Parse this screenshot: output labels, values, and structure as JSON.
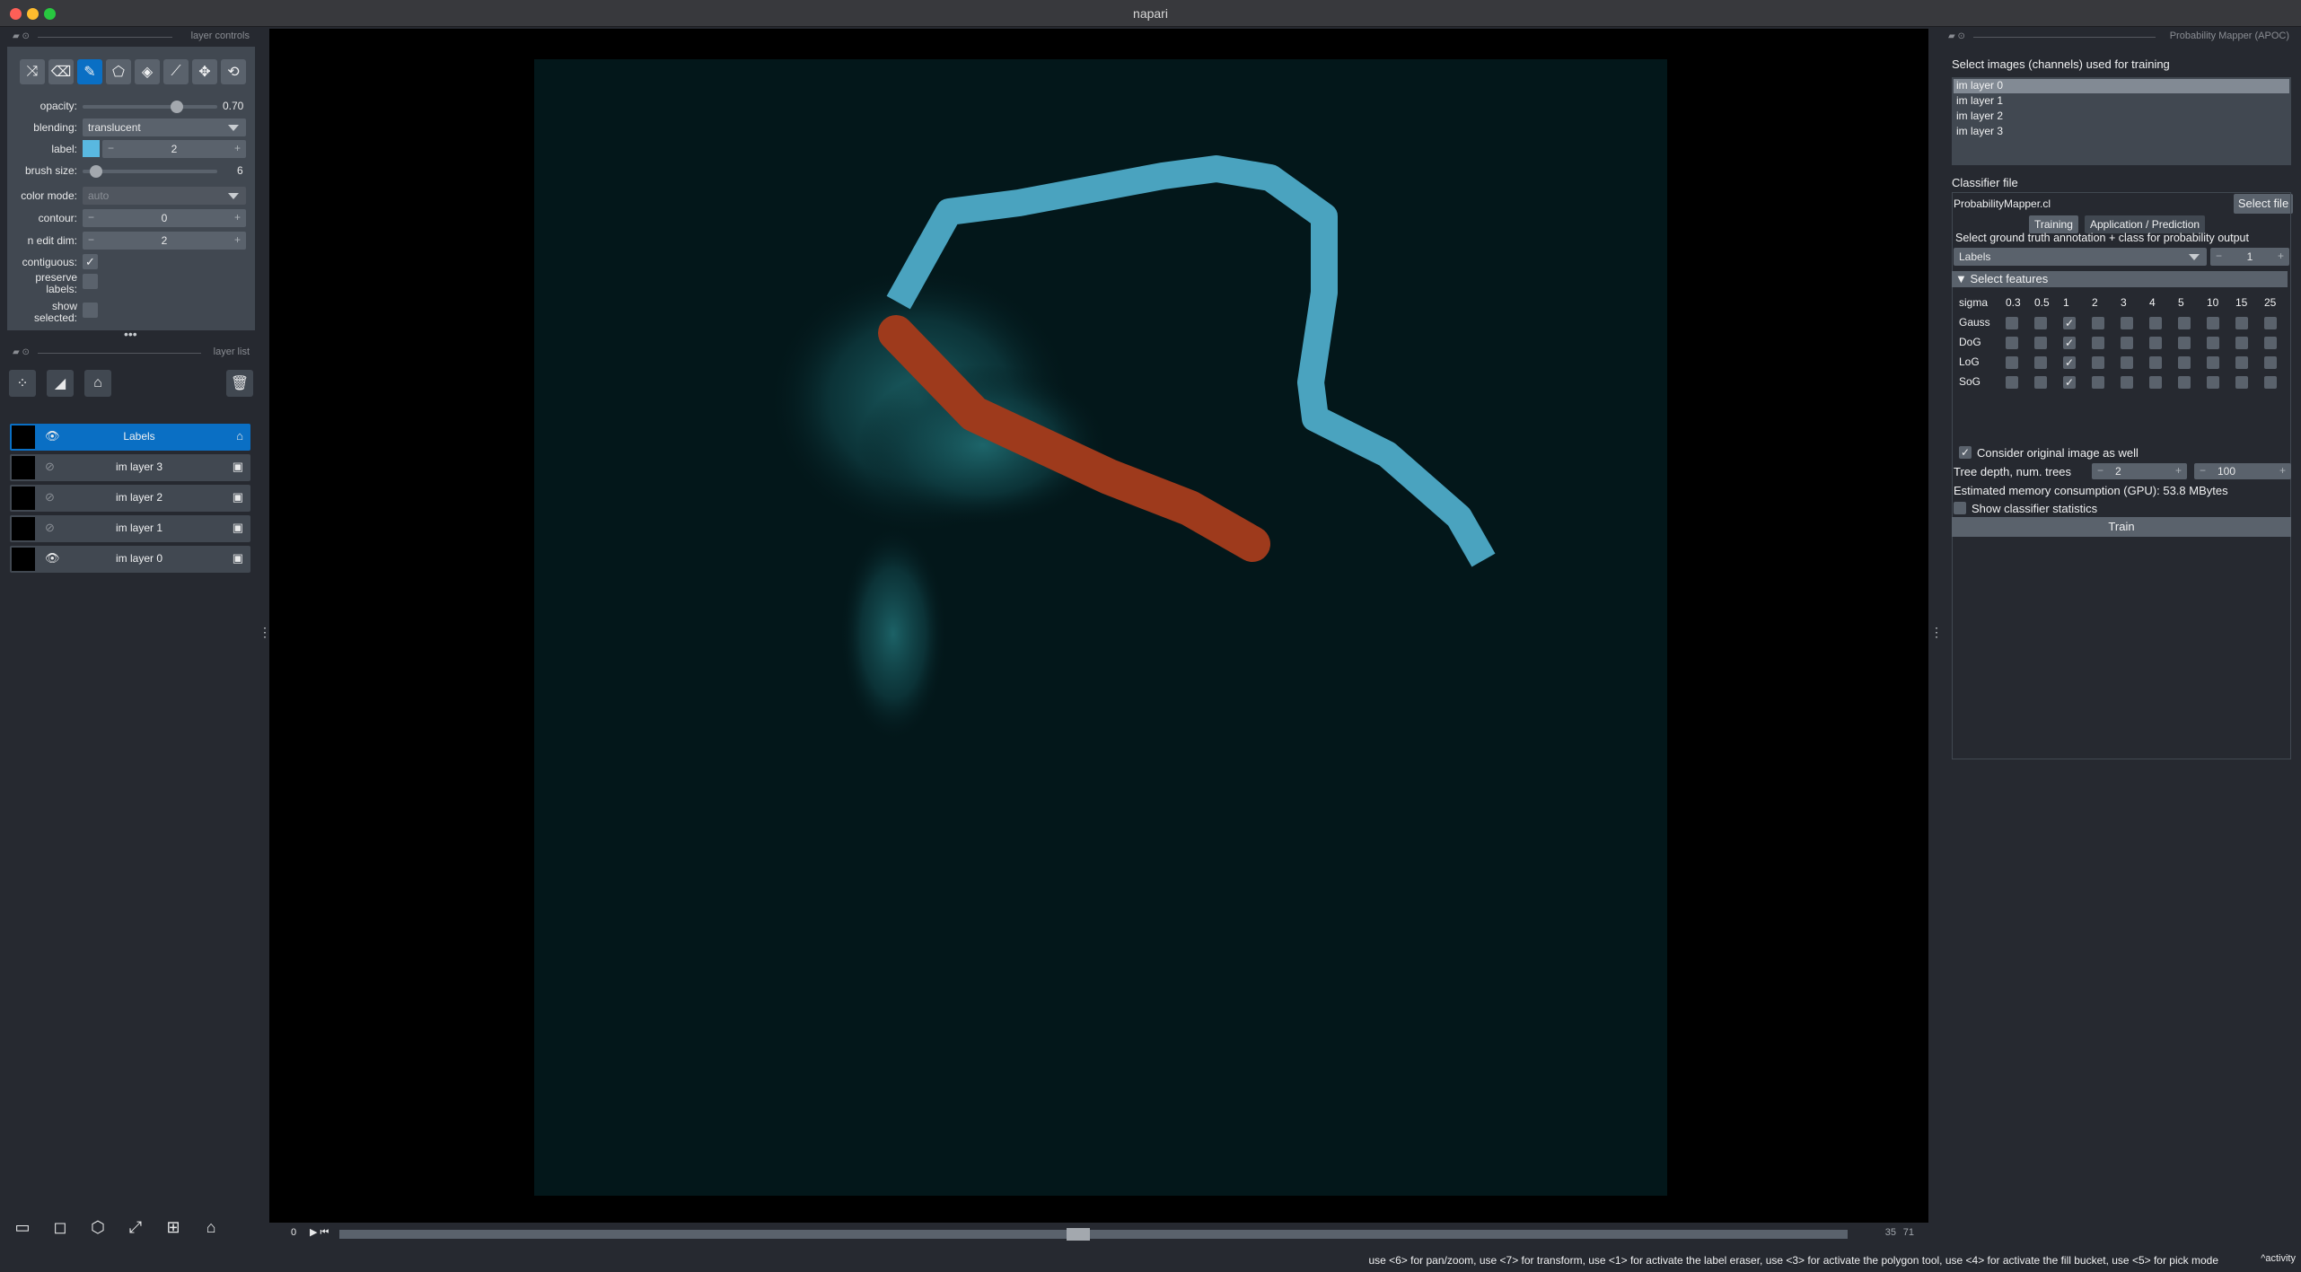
{
  "window": {
    "title": "napari"
  },
  "left_dock": {
    "controls_title": "layer controls",
    "list_title": "layer list",
    "tools": [
      "shuffle-icon",
      "eraser-icon",
      "paint-brush-icon",
      "polygon-icon",
      "fill-bucket-icon",
      "color-picker-icon",
      "pan-zoom-icon",
      "transform-icon"
    ],
    "active_tool_index": 2,
    "opacity_label": "opacity:",
    "opacity_value": "0.70",
    "opacity_fraction": 0.7,
    "blending_label": "blending:",
    "blending_value": "translucent",
    "label_label": "label:",
    "label_value": "2",
    "label_color": "#59b8e0",
    "brush_label": "brush size:",
    "brush_value": "6",
    "brush_fraction": 0.1,
    "colormode_label": "color mode:",
    "colormode_value": "auto",
    "contour_label": "contour:",
    "contour_value": "0",
    "ndim_label": "n edit dim:",
    "ndim_value": "2",
    "contiguous_label": "contiguous:",
    "contiguous_checked": true,
    "preserve_label": "preserve labels:",
    "preserve_checked": false,
    "show_selected_label": "show selected:",
    "show_selected_checked": false
  },
  "layers": [
    {
      "name": "Labels",
      "visible": true,
      "selected": true,
      "type": "labels"
    },
    {
      "name": "im layer 3",
      "visible": false,
      "selected": false,
      "type": "image"
    },
    {
      "name": "im layer 2",
      "visible": false,
      "selected": false,
      "type": "image"
    },
    {
      "name": "im layer 1",
      "visible": false,
      "selected": false,
      "type": "image"
    },
    {
      "name": "im layer 0",
      "visible": true,
      "selected": false,
      "type": "image"
    }
  ],
  "dims": {
    "start": "0",
    "current": "35",
    "total": "71",
    "fraction": 0.49
  },
  "status": {
    "message": "use <6> for pan/zoom, use <7> for transform, use <1> for activate the label eraser, use <3> for activate the polygon tool, use <4> for activate the fill bucket, use <5> for pick mode",
    "activity": "activity"
  },
  "apoc": {
    "title": "Probability Mapper (APOC)",
    "select_images_label": "Select images (channels) used for training",
    "images": [
      "im layer 0",
      "im layer 1",
      "im layer 2",
      "im layer 3"
    ],
    "selected_image_index": 0,
    "classifier_label": "Classifier file",
    "classifier_value": "ProbabilityMapper.cl",
    "select_file_button": "Select file",
    "tab_training": "Training",
    "tab_application": "Application / Prediction",
    "ground_truth_label": "Select ground truth annotation + class for probability output",
    "ground_truth_value": "Labels",
    "class_value": "1",
    "features_header": "Select features",
    "sigma_label": "sigma",
    "sigmas": [
      "0.3",
      "0.5",
      "1",
      "2",
      "3",
      "4",
      "5",
      "10",
      "15",
      "25"
    ],
    "feature_rows": [
      "Gauss",
      "DoG",
      "LoG",
      "SoG"
    ],
    "checked_sigma_index": 2,
    "original_image_label": "Consider original image as well",
    "original_image_checked": true,
    "tree_label": "Tree depth, num. trees",
    "tree_depth": "2",
    "num_trees": "100",
    "memory_label": "Estimated memory consumption (GPU): 53.8 MBytes",
    "stats_label": "Show classifier statistics",
    "stats_checked": false,
    "train_button": "Train"
  },
  "colors": {
    "label1": "#4aa3bf",
    "label2": "#9e3a1c",
    "accent": "#0a6fc4"
  }
}
